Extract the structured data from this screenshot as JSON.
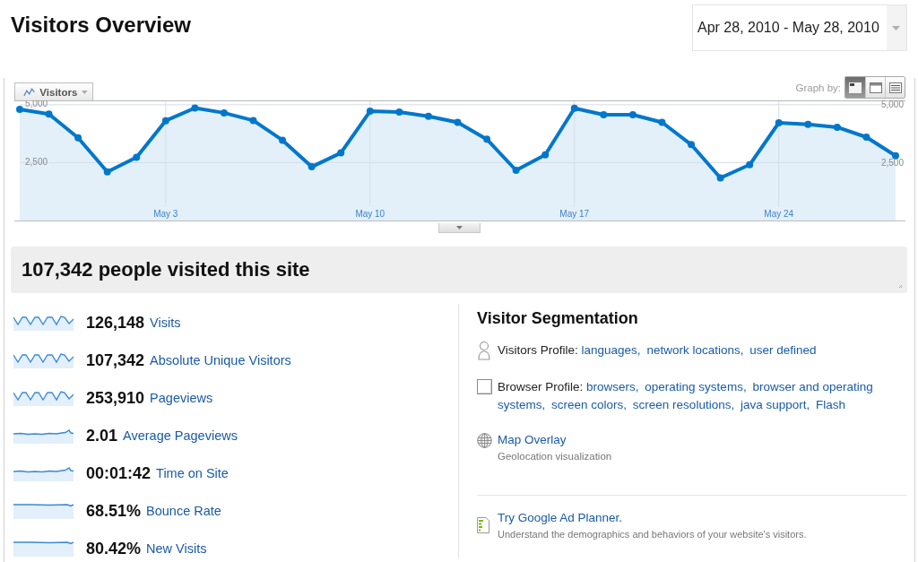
{
  "title": "Visitors Overview",
  "date_range": {
    "value": "Apr 28, 2010 - May 28, 2010"
  },
  "chart": {
    "graph_by": {
      "label": "Graph by:",
      "options": [
        {
          "kind": "day",
          "selected": true
        },
        {
          "kind": "week",
          "selected": false
        },
        {
          "kind": "month",
          "selected": false
        }
      ]
    },
    "chart_data": {
      "type": "area",
      "categories": [
        null,
        null,
        null,
        null,
        null,
        "May 3",
        null,
        null,
        null,
        null,
        null,
        null,
        "May 10",
        null,
        null,
        null,
        null,
        null,
        null,
        "May 17",
        null,
        null,
        null,
        null,
        null,
        null,
        "May 24",
        null,
        null,
        null,
        null
      ],
      "series": [
        {
          "name": "Visitors",
          "color": "#0077cc",
          "values": [
            4800,
            4600,
            3570,
            2100,
            2730,
            4310,
            4860,
            4650,
            4320,
            3470,
            2320,
            2920,
            4720,
            4690,
            4500,
            4240,
            3510,
            2170,
            2840,
            4850,
            4570,
            4570,
            4240,
            3280,
            1840,
            2410,
            4220,
            4150,
            4030,
            3600,
            2800
          ]
        }
      ],
      "ylim": [
        0,
        5150
      ],
      "yticks": [
        {
          "value": 5000,
          "label": "5,000"
        },
        {
          "value": 2500,
          "label": "2,500"
        }
      ],
      "grid": true
    }
  },
  "summary": {
    "title": "107,342 people visited this site"
  },
  "metrics": [
    {
      "value": "126,148",
      "label": "Visits",
      "kind": "wavy"
    },
    {
      "value": "107,342",
      "label": "Absolute Unique Visitors",
      "kind": "wavy"
    },
    {
      "value": "253,910",
      "label": "Pageviews",
      "kind": "wavy"
    },
    {
      "value": "2.01",
      "label": "Average Pageviews",
      "kind": "bumpy"
    },
    {
      "value": "00:01:42",
      "label": "Time on Site",
      "kind": "bumpy"
    },
    {
      "value": "68.51%",
      "label": "Bounce Rate",
      "kind": "flat"
    },
    {
      "value": "80.42%",
      "label": "New Visits",
      "kind": "flat"
    }
  ],
  "segmentation": {
    "title": "Visitor Segmentation",
    "items": [
      {
        "kind": "visitor-profile",
        "label": "Visitors Profile:",
        "links": [
          "languages,",
          "network locations,",
          "user defined"
        ]
      },
      {
        "kind": "browser-profile",
        "label": "Browser Profile:",
        "links": [
          "browsers,",
          "operating systems,",
          "browser and operating",
          "systems,",
          "screen colors,",
          "screen resolutions,",
          "java support,",
          "Flash"
        ]
      },
      {
        "kind": "map-overlay",
        "link": "Map Overlay",
        "description": "Geolocation visualization"
      }
    ]
  },
  "promo": {
    "link": "Try Google Ad Planner.",
    "description": "Understand the demographics and behaviors of your website's visitors."
  }
}
